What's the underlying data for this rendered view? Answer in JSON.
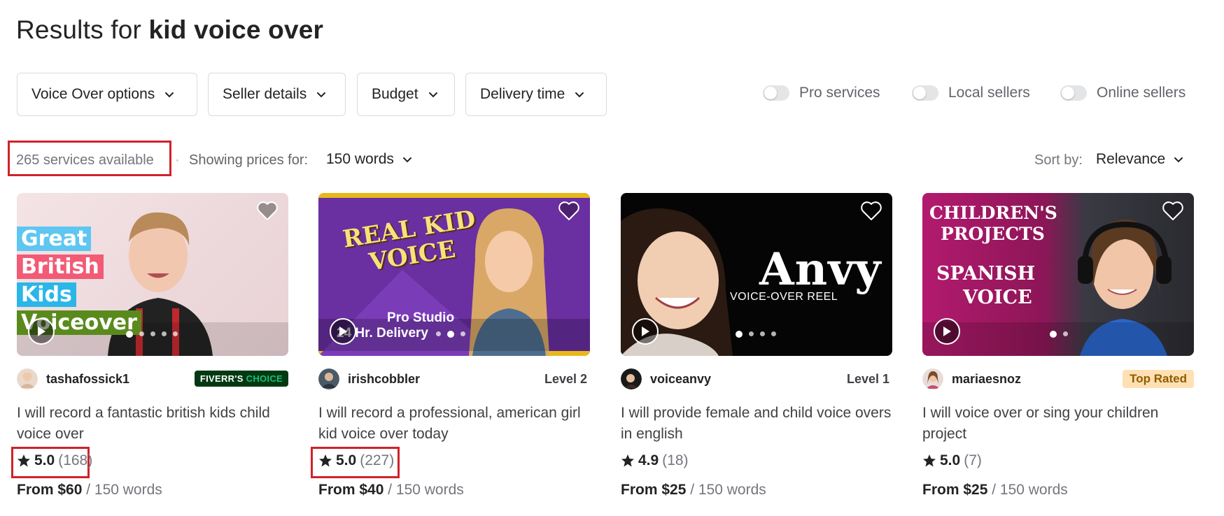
{
  "header": {
    "results_prefix": "Results for",
    "query": "kid voice over"
  },
  "filters": [
    {
      "label": "Voice Over options"
    },
    {
      "label": "Seller details"
    },
    {
      "label": "Budget"
    },
    {
      "label": "Delivery time"
    }
  ],
  "toggles": [
    {
      "label": "Pro services",
      "on": false
    },
    {
      "label": "Local sellers",
      "on": false
    },
    {
      "label": "Online sellers",
      "on": false
    }
  ],
  "summary": {
    "count_text": "265 services available",
    "separator": "·",
    "showing_label": "Showing prices for:",
    "words_value": "150 words",
    "sort_label": "Sort by:",
    "sort_value": "Relevance"
  },
  "colors": {
    "highlight": "#d0222b",
    "fiverr_green": "#1dbf73",
    "top_rated_bg": "#ffe0b3"
  },
  "gigs": [
    {
      "thumb_text": [
        "Great",
        "British",
        "Kids",
        "Voiceover"
      ],
      "seller": "tashafossick1",
      "badge": {
        "type": "fiverrs-choice",
        "prefix": "FIVERR'S",
        "suffix": "CHOICE"
      },
      "title": "I will record a fantastic british kids child voice over",
      "rating": "5.0",
      "reviews": "(168)",
      "price": "From $60",
      "per": "/ 150 words",
      "dots_total": 5,
      "dots_active": 1,
      "highlighted_rating": true
    },
    {
      "thumb_text": [
        "REAL KID",
        "VOICE",
        "Pro Studio",
        "24 Hr. Delivery"
      ],
      "seller": "irishcobbler",
      "badge": {
        "type": "level",
        "text": "Level 2"
      },
      "title": "I will record a professional, american girl kid voice over today",
      "rating": "5.0",
      "reviews": "(227)",
      "price": "From $40",
      "per": "/ 150 words",
      "dots_total": 3,
      "dots_active": 2,
      "highlighted_rating": true
    },
    {
      "thumb_text": [
        "Anvy",
        "VOICE-OVER REEL"
      ],
      "seller": "voiceanvy",
      "badge": {
        "type": "level",
        "text": "Level 1"
      },
      "title": "I will provide female and child voice overs in english",
      "rating": "4.9",
      "reviews": "(18)",
      "price": "From $25",
      "per": "/ 150 words",
      "dots_total": 4,
      "dots_active": 0,
      "highlighted_rating": false
    },
    {
      "thumb_text": [
        "CHILDREN'S",
        "PROJECTS",
        "SPANISH",
        "VOICE"
      ],
      "seller": "mariaesnoz",
      "badge": {
        "type": "top-rated",
        "text": "Top Rated"
      },
      "title": "I will voice over or sing your children project",
      "rating": "5.0",
      "reviews": "(7)",
      "price": "From $25",
      "per": "/ 150 words",
      "dots_total": 2,
      "dots_active": 0,
      "highlighted_rating": false
    }
  ]
}
